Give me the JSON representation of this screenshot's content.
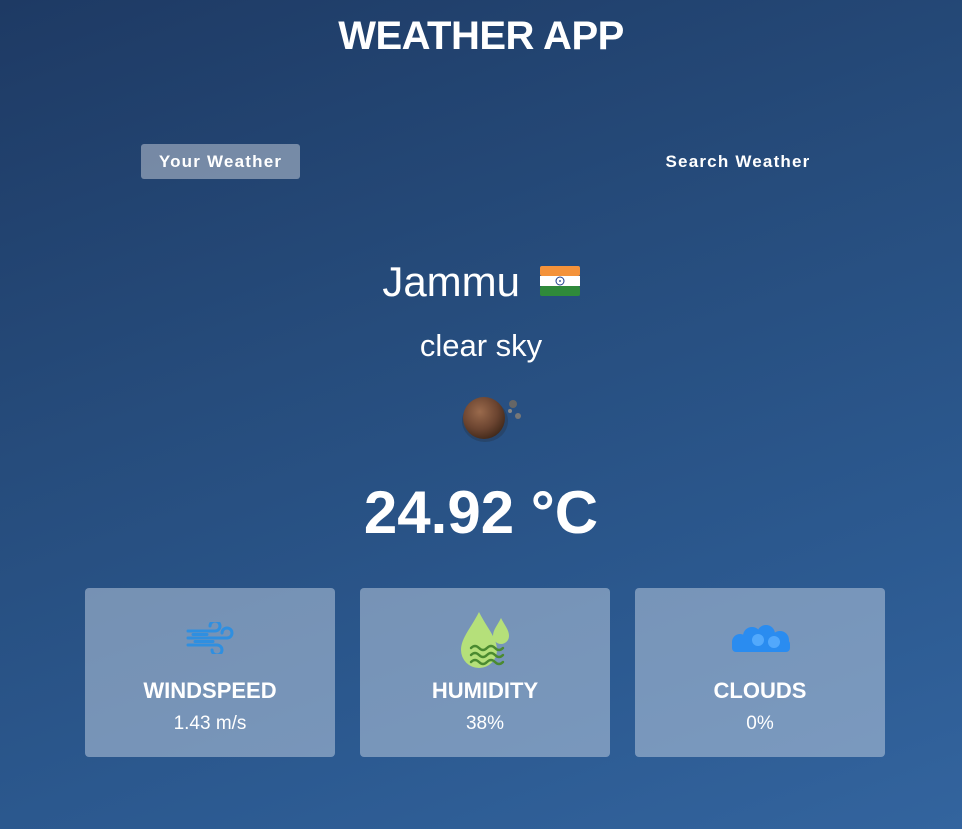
{
  "app": {
    "title": "WEATHER APP"
  },
  "tabs": [
    {
      "label": "Your Weather",
      "active": true
    },
    {
      "label": "Search Weather",
      "active": false
    }
  ],
  "current": {
    "city": "Jammu",
    "country_flag_icon": "india-flag-icon",
    "description": "clear sky",
    "weather_icon": "clear-sky-night-moon-icon",
    "temperature": "24.92 °C"
  },
  "stats": [
    {
      "label": "WINDSPEED",
      "value": "1.43 m/s",
      "icon": "wind-icon"
    },
    {
      "label": "HUMIDITY",
      "value": "38%",
      "icon": "humidity-drops-icon"
    },
    {
      "label": "CLOUDS",
      "value": "0%",
      "icon": "clouds-icon"
    }
  ],
  "colors": {
    "background_top": "#1e3a64",
    "background_bottom": "#33649e",
    "wind_icon": "#2f8fe0",
    "humidity_icon": "#b5e07a",
    "clouds_icon": "#2a8cf0"
  }
}
